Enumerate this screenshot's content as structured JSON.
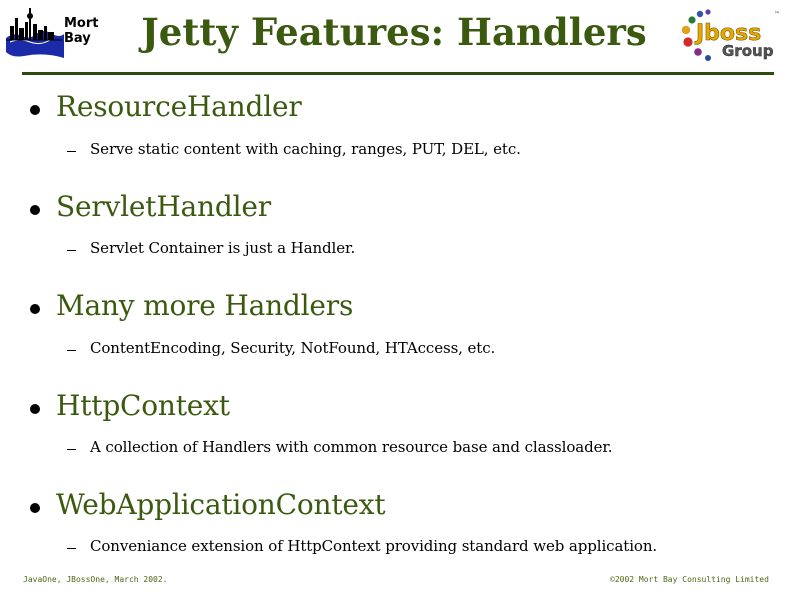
{
  "header": {
    "title": "Jetty Features: Handlers",
    "logo_left": {
      "icon": "mort-bay-skyline-logo",
      "line1": "Mort",
      "line2": "Bay"
    },
    "logo_right": {
      "icon": "jboss-group-logo",
      "word1": "Jboss",
      "word2": "Group",
      "tm": "™"
    }
  },
  "items": [
    {
      "title": "ResourceHandler",
      "sub": "Serve static content with caching, ranges, PUT, DEL, etc."
    },
    {
      "title": "ServletHandler",
      "sub": "Servlet Container is just a Handler."
    },
    {
      "title": "Many more Handlers",
      "sub": "ContentEncoding, Security, NotFound, HTAccess, etc."
    },
    {
      "title": "HttpContext",
      "sub": "A collection of Handlers with common resource base and classloader."
    },
    {
      "title": "WebApplicationContext",
      "sub": "Conveniance extension of HttpContext providing standard web application."
    }
  ],
  "footer": {
    "left": "JavaOne, JBossOne, March 2002.",
    "right": "©2002 Mort Bay Consulting Limited"
  },
  "colors": {
    "title": "#3b5a10",
    "rule": "#2f4a10",
    "text": "#000000"
  }
}
